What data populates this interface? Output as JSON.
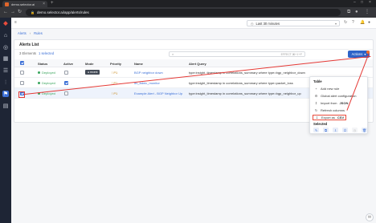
{
  "browser": {
    "tab_title": "demo.selector.ai",
    "url": "demo.selector.ai/app/alerts/rules",
    "new_tab": "+",
    "close": "×",
    "window": {
      "minimize": "–",
      "maximize": "□",
      "close": "×"
    }
  },
  "topbar": {
    "time_range": "Last 30 minutes"
  },
  "breadcrumb": {
    "items": [
      "Alerts",
      "Rules"
    ]
  },
  "card": {
    "title": "Alerts List",
    "count_label": "3 Elements",
    "selected_label": "1 selected",
    "search_hint": "EFFECT ⌘+⇧+F",
    "actions_label": "Actions",
    "columns": [
      "Status",
      "Active",
      "Mode",
      "Priority",
      "Name",
      "Alert Query"
    ],
    "rows": [
      {
        "status": "Deployed",
        "active": false,
        "mode": "",
        "mode_badge": "● recent",
        "priority": "P1",
        "name": "BGP neighbor down",
        "query": "type:insight_timestamp in correlations_summary where type=bgp_neighbor_down"
      },
      {
        "status": "Deployed",
        "active": true,
        "mode": "",
        "mode_badge": "",
        "priority": "P1",
        "name": "dx_fabric_monitor",
        "query": "type:insight_timestamp in correlations_summary where type=packet_loss"
      },
      {
        "status": "Deployed",
        "active": false,
        "mode": "",
        "mode_badge": "",
        "priority": "P1",
        "name": "Example Alert - BGP Neighbor Up",
        "query": "type:insight_timestamp in correlations_summary where type=bgp_neighbor_up"
      }
    ]
  },
  "menu": {
    "table_heading": "Table",
    "items": [
      {
        "label": "Add new rule",
        "icon": "+"
      },
      {
        "label": "Global alert configuration",
        "icon": "⚙"
      },
      {
        "label": "Import from",
        "emph": "JSON",
        "icon": "↥"
      },
      {
        "label": "Refresh columns",
        "icon": "↻"
      },
      {
        "label": "Export as",
        "emph": "CSV",
        "icon": "↧"
      }
    ],
    "selected_heading": "Selected",
    "selected_icons": [
      "✎",
      "⧉",
      "⇩",
      "⏻",
      "◷",
      "🗑"
    ]
  },
  "colors": {
    "accent": "#2d63c8",
    "annotation": "#e53935",
    "deployed": "#3aa55d",
    "sidebar": "#1e2535"
  }
}
